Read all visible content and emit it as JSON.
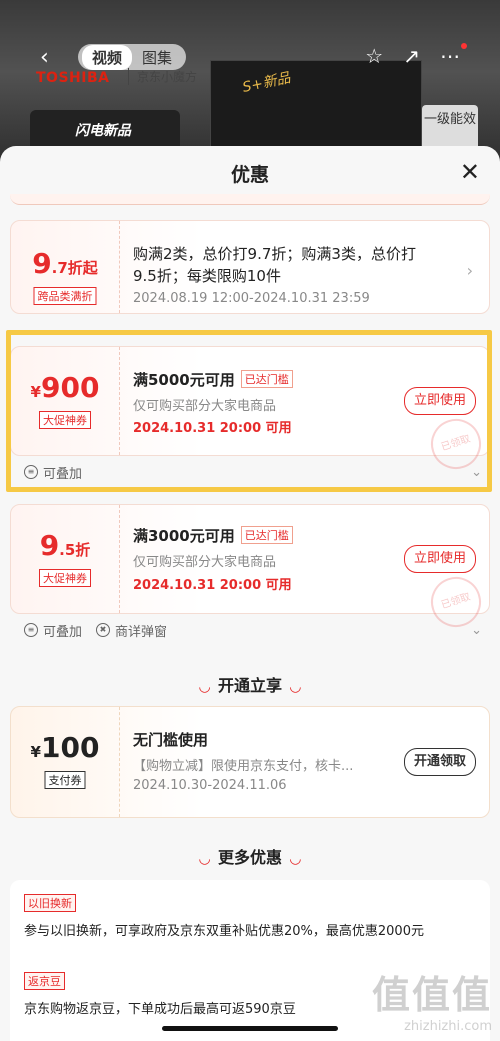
{
  "header": {
    "tabs": [
      "视频",
      "图集"
    ],
    "brand": "TOSHIBA",
    "brand2": "京东小魔方",
    "new_tag": "S+新品",
    "banner_text": "闪电新品",
    "level_label": "一级能效"
  },
  "sheet": {
    "title": "优惠"
  },
  "coupons": [
    {
      "value_big": "9",
      "value_small": ".7折起",
      "tag": "跨品类满折",
      "title_line1": "购满2类，总价打9.7折；购满3类，总价打",
      "title_line2": "9.5折；每类限购10件",
      "date": "2024.08.19 12:00-2024.10.31 23:59"
    },
    {
      "currency": "¥",
      "value_big": "900",
      "tag": "大促神券",
      "title": "满5000元可用",
      "pill": "已达门槛",
      "desc": "仅可购买部分大家电商品",
      "date": "2024.10.31 20:00 可用",
      "button": "立即使用",
      "stackable": "可叠加",
      "stamp": "已领取"
    },
    {
      "value_big": "9",
      "value_small": ".5折",
      "tag": "大促神券",
      "title": "满3000元可用",
      "pill": "已达门槛",
      "desc": "仅可购买部分大家电商品",
      "date": "2024.10.31 20:00 可用",
      "button": "立即使用",
      "stackable": "可叠加",
      "popup": "商详弹窗",
      "stamp": "已领取"
    }
  ],
  "section_open": "开通立享",
  "pay_coupon": {
    "currency": "¥",
    "value_big": "100",
    "tag": "支付券",
    "title": "无门槛使用",
    "desc": "【购物立减】限使用京东支付，核卡...",
    "date": "2024.10.30-2024.11.06",
    "button": "开通领取"
  },
  "section_more": "更多优惠",
  "more": [
    {
      "tag": "以旧换新",
      "text": "参与以旧换新，可享政府及京东双重补贴优惠20%，最高优惠2000元"
    },
    {
      "tag": "返京豆",
      "text": "京东购物返京豆，下单成功后最高可返590京豆"
    }
  ],
  "watermark": {
    "glyphs": "值值值",
    "url": "zhizhizhi.com"
  },
  "colors": {
    "accent": "#e62b2b",
    "highlight": "#f6c945"
  }
}
